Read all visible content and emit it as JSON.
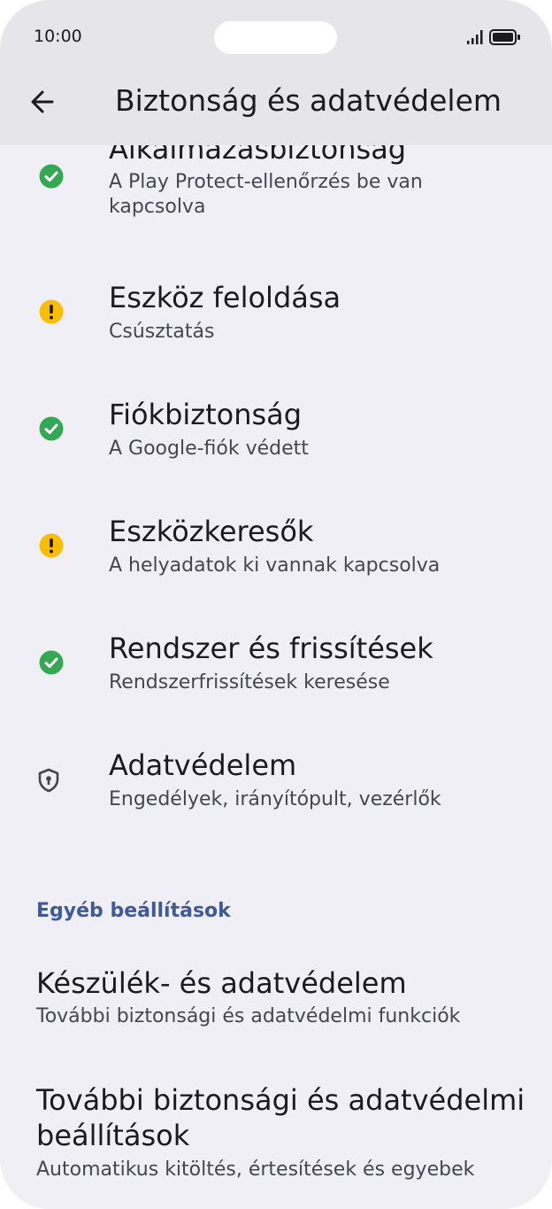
{
  "status": {
    "time": "10:00"
  },
  "header": {
    "title": "Biztonság és adatvédelem"
  },
  "items": [
    {
      "title": "Alkalmazásbiztonság",
      "subtitle": "A Play Protect-ellenőrzés be van kapcsolva",
      "status": "ok"
    },
    {
      "title": "Eszköz feloldása",
      "subtitle": "Csúsztatás",
      "status": "warning"
    },
    {
      "title": "Fiókbiztonság",
      "subtitle": "A Google-fiók védett",
      "status": "ok"
    },
    {
      "title": "Eszközkeresők",
      "subtitle": "A helyadatok ki vannak kapcsolva",
      "status": "warning"
    },
    {
      "title": "Rendszer és frissítések",
      "subtitle": "Rendszerfrissítések keresése",
      "status": "ok"
    },
    {
      "title": "Adatvédelem",
      "subtitle": "Engedélyek, irányítópult, vezérlők",
      "status": "privacy"
    }
  ],
  "other": {
    "heading": "Egyéb beállítások",
    "items": [
      {
        "title": "Készülék- és adatvédelem",
        "subtitle": "További biztonsági és adatvédelmi funkciók"
      },
      {
        "title": "További biztonsági és adatvédelmi beállítások",
        "subtitle": "Automatikus kitöltés, értesítések és egyebek"
      }
    ]
  },
  "colors": {
    "ok": "#34a853",
    "warning": "#fbbc04",
    "accent": "#3f5a9a"
  }
}
